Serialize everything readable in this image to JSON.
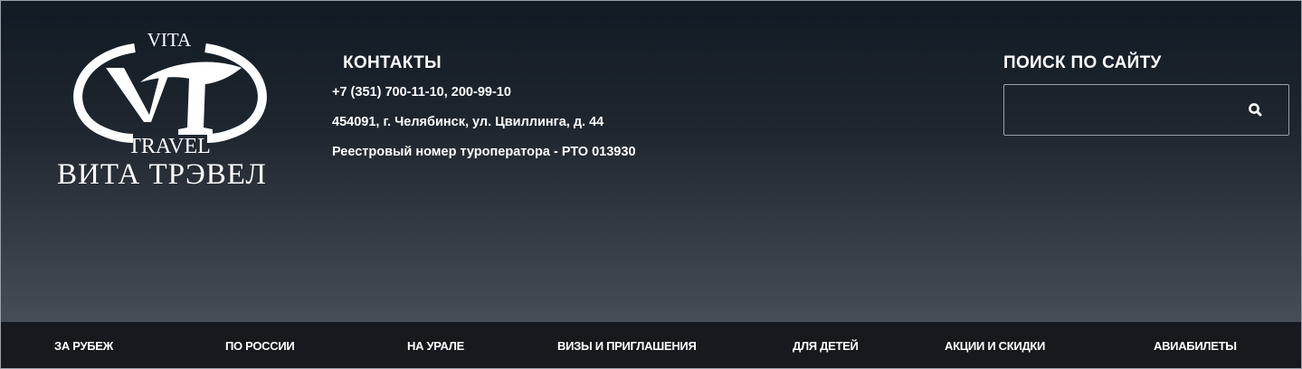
{
  "logo": {
    "top_text": "VITA",
    "bottom_text": "TRAVEL",
    "russian_name": "ВИТА ТРЭВЕЛ"
  },
  "contacts": {
    "title": "КОНТАКТЫ",
    "phone": "+7 (351) 700-11-10, 200-99-10",
    "address": "454091, г. Челябинск, ул. Цвиллинга, д. 44",
    "registry": "Реестровый номер туроператора - РТО 013930"
  },
  "search": {
    "title": "ПОИСК ПО САЙТУ",
    "value": "",
    "icon": "search-icon"
  },
  "nav": {
    "items": [
      {
        "label": "ЗА РУБЕЖ"
      },
      {
        "label": "ПО РОССИИ"
      },
      {
        "label": "НА УРАЛЕ"
      },
      {
        "label": "ВИЗЫ И ПРИГЛАШЕНИЯ"
      },
      {
        "label": "ДЛЯ ДЕТЕЙ"
      },
      {
        "label": "АКЦИИ И СКИДКИ"
      },
      {
        "label": "АВИАБИЛЕТЫ"
      }
    ]
  },
  "colors": {
    "header_top": "#111b24",
    "header_bottom": "#474d57",
    "nav_background": "#161a1f",
    "text": "#ffffff"
  }
}
